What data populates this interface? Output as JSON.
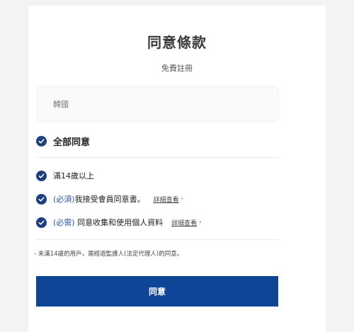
{
  "header": {
    "title": "同意條款",
    "subtitle": "免費註冊"
  },
  "country": {
    "value": "韓國"
  },
  "agreements": {
    "all_label": "全部同意",
    "items": [
      {
        "prefix": "",
        "label": "滿14歲以上",
        "detail": ""
      },
      {
        "prefix": "(必須)",
        "label": "我接受會員同意書。",
        "detail": "詳細查看"
      },
      {
        "prefix": "(必需)",
        "label": " 同意收集和使用個人資料",
        "detail": "詳細查看"
      }
    ],
    "chevron": "›"
  },
  "notice": "- 未滿14歲的用戶，需經過監護人(法定代理人)的同意。",
  "agree_button": {
    "label": "同意"
  },
  "colors": {
    "accent": "#0f4596",
    "check": "#1d3f7f",
    "required_text": "#2b57a7"
  },
  "icons": {
    "check": "check-circle-icon",
    "chevron": "chevron-right-icon"
  }
}
